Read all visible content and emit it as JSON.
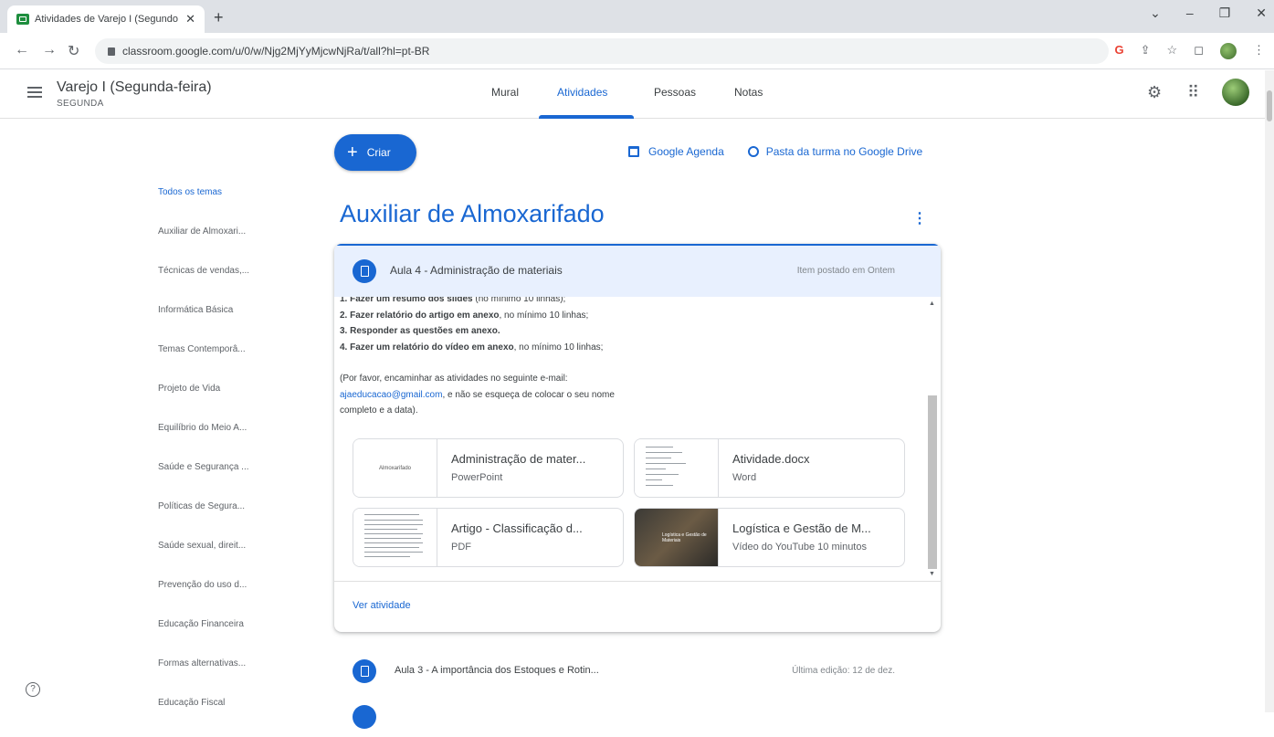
{
  "browser": {
    "tab_title": "Atividades de Varejo I (Segundo",
    "tab_close": "✕",
    "new_tab": "+",
    "url": "classroom.google.com/u/0/w/Njg2MjYyMjcwNjRa/t/all?hl=pt-BR",
    "window_controls": [
      "⌄",
      "–",
      "❐",
      "✕"
    ]
  },
  "header": {
    "class_name": "Varejo I (Segunda-feira)",
    "class_section": "SEGUNDA",
    "tabs": [
      {
        "label": "Mural",
        "active": false
      },
      {
        "label": "Atividades",
        "active": true
      },
      {
        "label": "Pessoas",
        "active": false
      },
      {
        "label": "Notas",
        "active": false
      }
    ]
  },
  "toolbar": {
    "create_label": "Criar",
    "calendar_label": "Google Agenda",
    "drive_label": "Pasta da turma no Google Drive"
  },
  "sidebar": {
    "items": [
      {
        "label": "Todos os temas",
        "active": true
      },
      {
        "label": "Auxiliar de Almoxari..."
      },
      {
        "label": "Técnicas de vendas,..."
      },
      {
        "label": "Informática Básica"
      },
      {
        "label": "Temas Contemporâ..."
      },
      {
        "label": "Projeto de Vida"
      },
      {
        "label": "Equilíbrio do Meio A..."
      },
      {
        "label": "Saúde e Segurança ..."
      },
      {
        "label": "Políticas de Segura..."
      },
      {
        "label": "Saúde sexual, direit..."
      },
      {
        "label": "Prevenção do uso d..."
      },
      {
        "label": "Educação Financeira"
      },
      {
        "label": "Formas alternativas..."
      },
      {
        "label": "Educação Fiscal"
      }
    ]
  },
  "topic": {
    "title": "Auxiliar de Almoxarifado",
    "more_icon": "⋮"
  },
  "assignment": {
    "title": "Aula 4 - Administração de materiais",
    "meta": "Item postado em Ontem",
    "desc_line1_bold": "1. Fazer um resumo dos slides",
    "desc_line1_rest": " (no mínimo 10 linhas);",
    "desc_line2_bold": "2. Fazer relatório do artigo em anexo",
    "desc_line2_rest": ", no mínimo 10 linhas;",
    "desc_line3_bold": "3. Responder as questões em anexo.",
    "desc_line4_bold": "4. Fazer um relatório do vídeo em anexo",
    "desc_line4_rest": ", no mínimo 10 linhas;",
    "desc_para_1": "(Por favor, encaminhar as atividades no seguinte e-mail:",
    "desc_email": "ajaeducacao@gmail.com",
    "desc_para_2": ", e não se esqueça de colocar o seu nome",
    "desc_para_3": "completo e a data).",
    "attachments": [
      {
        "name": "Administração de mater...",
        "type": "PowerPoint",
        "thumb_text": "Almoxarifado"
      },
      {
        "name": "Atividade.docx",
        "type": "Word"
      },
      {
        "name": "Artigo - Classificação d...",
        "type": "PDF"
      },
      {
        "name": "Logística e Gestão de M...",
        "type": "Vídeo do YouTube   10 minutos",
        "thumb_text": "Logística e Gestão de Materiais"
      }
    ],
    "view_label": "Ver atividade"
  },
  "next_assignment": {
    "title": "Aula 3 - A importância dos Estoques e Rotin...",
    "meta": "Última edição: 12 de dez."
  },
  "colors": {
    "accent": "#1967d2",
    "card_header_bg": "#e8f0fe"
  }
}
